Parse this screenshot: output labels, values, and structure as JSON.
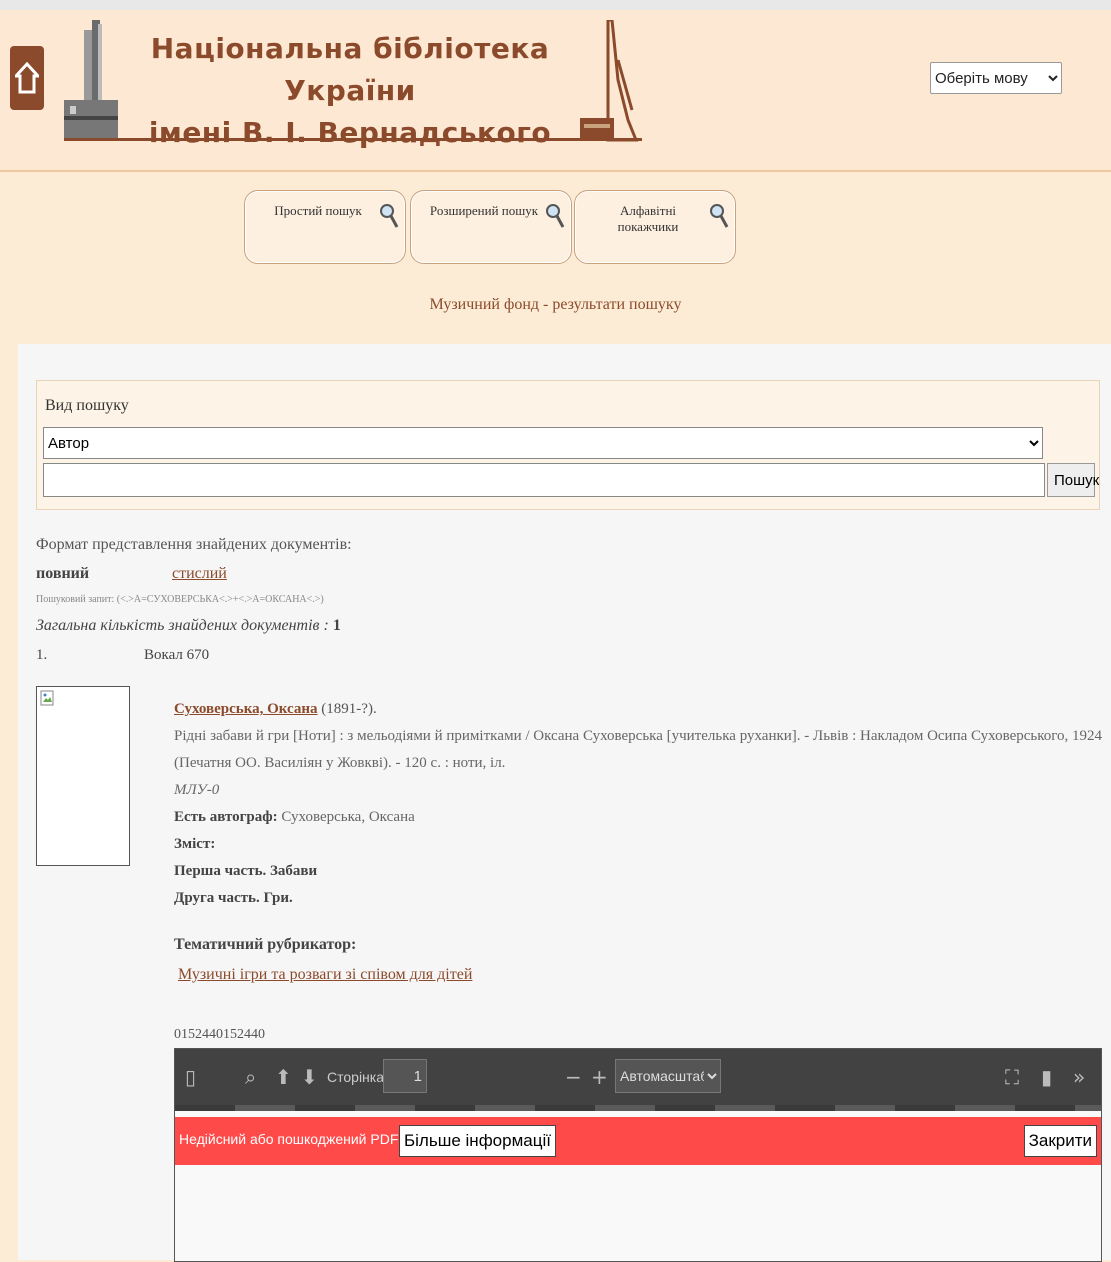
{
  "header": {
    "title_line1": "Національна бібліотека України",
    "title_line2": "імені В. І. Вернадського",
    "language_select": "Оберіть мову",
    "colors": {
      "brand": "#8b4a2b",
      "header_bg": "#fde9d3"
    }
  },
  "tabs": [
    {
      "label": "Простий пошук",
      "icon": "search-icon"
    },
    {
      "label": "Розширений пошук",
      "icon": "search-icon"
    },
    {
      "label": "Алфавітні покажчики",
      "icon": "search-icon"
    }
  ],
  "page_subtitle": "Музичний фонд - результати пошуку",
  "search": {
    "type_label": "Вид пошуку",
    "type_selected": "Автор",
    "query_value": "",
    "button": "Пошук"
  },
  "results": {
    "format_label": "Формат представлення знайдених документів:",
    "format_full": "повний",
    "format_brief": "стислий",
    "query_text": "Пошуковий запит: (<.>A=СУХОВЕРСЬКА<.>+<.>A=ОКСАНА<.>)",
    "total_label": "Загальна кількість знайдених документів : ",
    "total_count": "1"
  },
  "record": {
    "number": "1.",
    "code": "Вокал 670",
    "author": "Суховерська, Оксана",
    "dates": " (1891-?).",
    "description": "Рідні забави й гри [Ноти] : з мельодіями й приміткaми / Оксана Суховерська [учителька руханки]. - Львів : Накладом Осипа Суховерського, 1924 (Печатня ОО. Василіян у Жовкві). - 120 с. : ноти, іл.",
    "shelf": "МЛУ-0",
    "autograph_label": "Есть автограф:",
    "autograph_value": " Суховерська, Оксана",
    "contents_label": "Зміст:",
    "contents_part1": "Перша часть. Забави",
    "contents_part2": "Друга часть. Гри.",
    "rubric_label": "Тематичний рубрикатор:",
    "rubric_link": "Музичні ігри та розваги зі співом для дітей",
    "doc_id": "0152440152440"
  },
  "pdf_viewer": {
    "page_label": "Сторінка",
    "page_value": "1",
    "zoom": "Автомасштаб",
    "error_text": "Недійсний або пошкоджений PDF-файл",
    "more_button": "Більше інформації",
    "close_button": "Закрити",
    "error_color": "#ff4a4a"
  }
}
